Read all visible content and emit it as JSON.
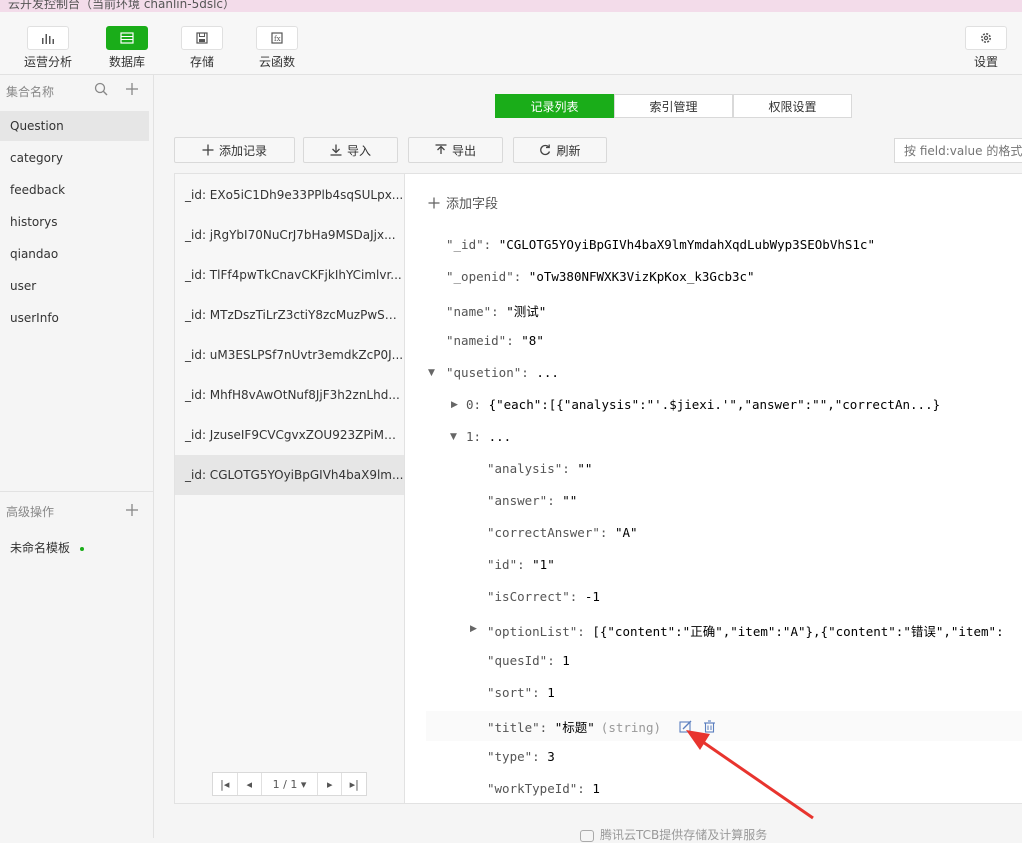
{
  "window": {
    "title": "云开发控制台（当前环境 chanlin-5dslc）"
  },
  "toolbar": {
    "items": [
      {
        "label": "运营分析"
      },
      {
        "label": "数据库"
      },
      {
        "label": "存储"
      },
      {
        "label": "云函数"
      }
    ],
    "settings_label": "设置"
  },
  "sidebar": {
    "collections_title": "集合名称",
    "collections": [
      "Question",
      "category",
      "feedback",
      "historys",
      "qiandao",
      "user",
      "userInfo"
    ],
    "advanced_title": "高级操作",
    "template_name": "未命名模板"
  },
  "tabs": [
    "记录列表",
    "索引管理",
    "权限设置"
  ],
  "actions": {
    "add_record": "添加记录",
    "import": "导入",
    "export": "导出",
    "refresh": "刷新"
  },
  "filter": {
    "placeholder": "按 field:value 的格式"
  },
  "records": [
    "_id: EXo5iC1Dh9e33PPlb4sqSULpx...",
    "_id: jRgYbI70NuCrJ7bHa9MSDaJjx...",
    "_id: TlFf4pwTkCnavCKFjkIhYCimlvr...",
    "_id: MTzDszTiLrZ3ctiY8zcMuzPwSU...",
    "_id: uM3ESLPSf7nUvtr3emdkZcP0J...",
    "_id: MhfH8vAwOtNuf8JjF3h2znLhd...",
    "_id: JzuseIF9CVCgvxZOU923ZPiMD...",
    "_id: CGLOTG5YOyiBpGIVh4baX9lm..."
  ],
  "pager": {
    "page": "1 / 1"
  },
  "detail": {
    "add_field": "添加字段",
    "fields": {
      "_id": {
        "key": "\"_id\": ",
        "value": "\"CGLOTG5YOyiBpGIVh4baX9lmYmdahXqdLubWyp3SEObVhS1c\""
      },
      "_openid": {
        "key": "\"_openid\": ",
        "value": "\"oTw380NFWXK3VizKpKox_k3Gcb3c\""
      },
      "name": {
        "key": "\"name\": ",
        "value": "\"测试\""
      },
      "nameid": {
        "key": "\"nameid\": ",
        "value": "\"8\""
      },
      "qusetion": {
        "key": "\"qusetion\": ",
        "value": "..."
      },
      "q0": {
        "key": "0: ",
        "value": "{\"each\":[{\"analysis\":\"'.$jiexi.'\",\"answer\":\"\",\"correctAn...}"
      },
      "q1": {
        "key": "1: ",
        "value": "..."
      },
      "analysis": {
        "key": "\"analysis\": ",
        "value": "\"\""
      },
      "answer": {
        "key": "\"answer\": ",
        "value": "\"\""
      },
      "correctAnswer": {
        "key": "\"correctAnswer\": ",
        "value": "\"A\""
      },
      "id": {
        "key": "\"id\": ",
        "value": "\"1\""
      },
      "isCorrect": {
        "key": "\"isCorrect\": ",
        "value": "-1"
      },
      "optionList": {
        "key": "\"optionList\": ",
        "value": "[{\"content\":\"正确\",\"item\":\"A\"},{\"content\":\"错误\",\"item\":"
      },
      "quesId": {
        "key": "\"quesId\": ",
        "value": "1"
      },
      "sort": {
        "key": "\"sort\": ",
        "value": "1"
      },
      "title": {
        "key": "\"title\": ",
        "value": "\"标题\"",
        "type": "(string)"
      },
      "type": {
        "key": "\"type\": ",
        "value": "3"
      },
      "workTypeId": {
        "key": "\"workTypeId\": ",
        "value": "1"
      }
    }
  },
  "footer": "腾讯云TCB提供存储及计算服务",
  "colors": {
    "accent": "#1aad19",
    "annotation_arrow": "#e8342e"
  }
}
